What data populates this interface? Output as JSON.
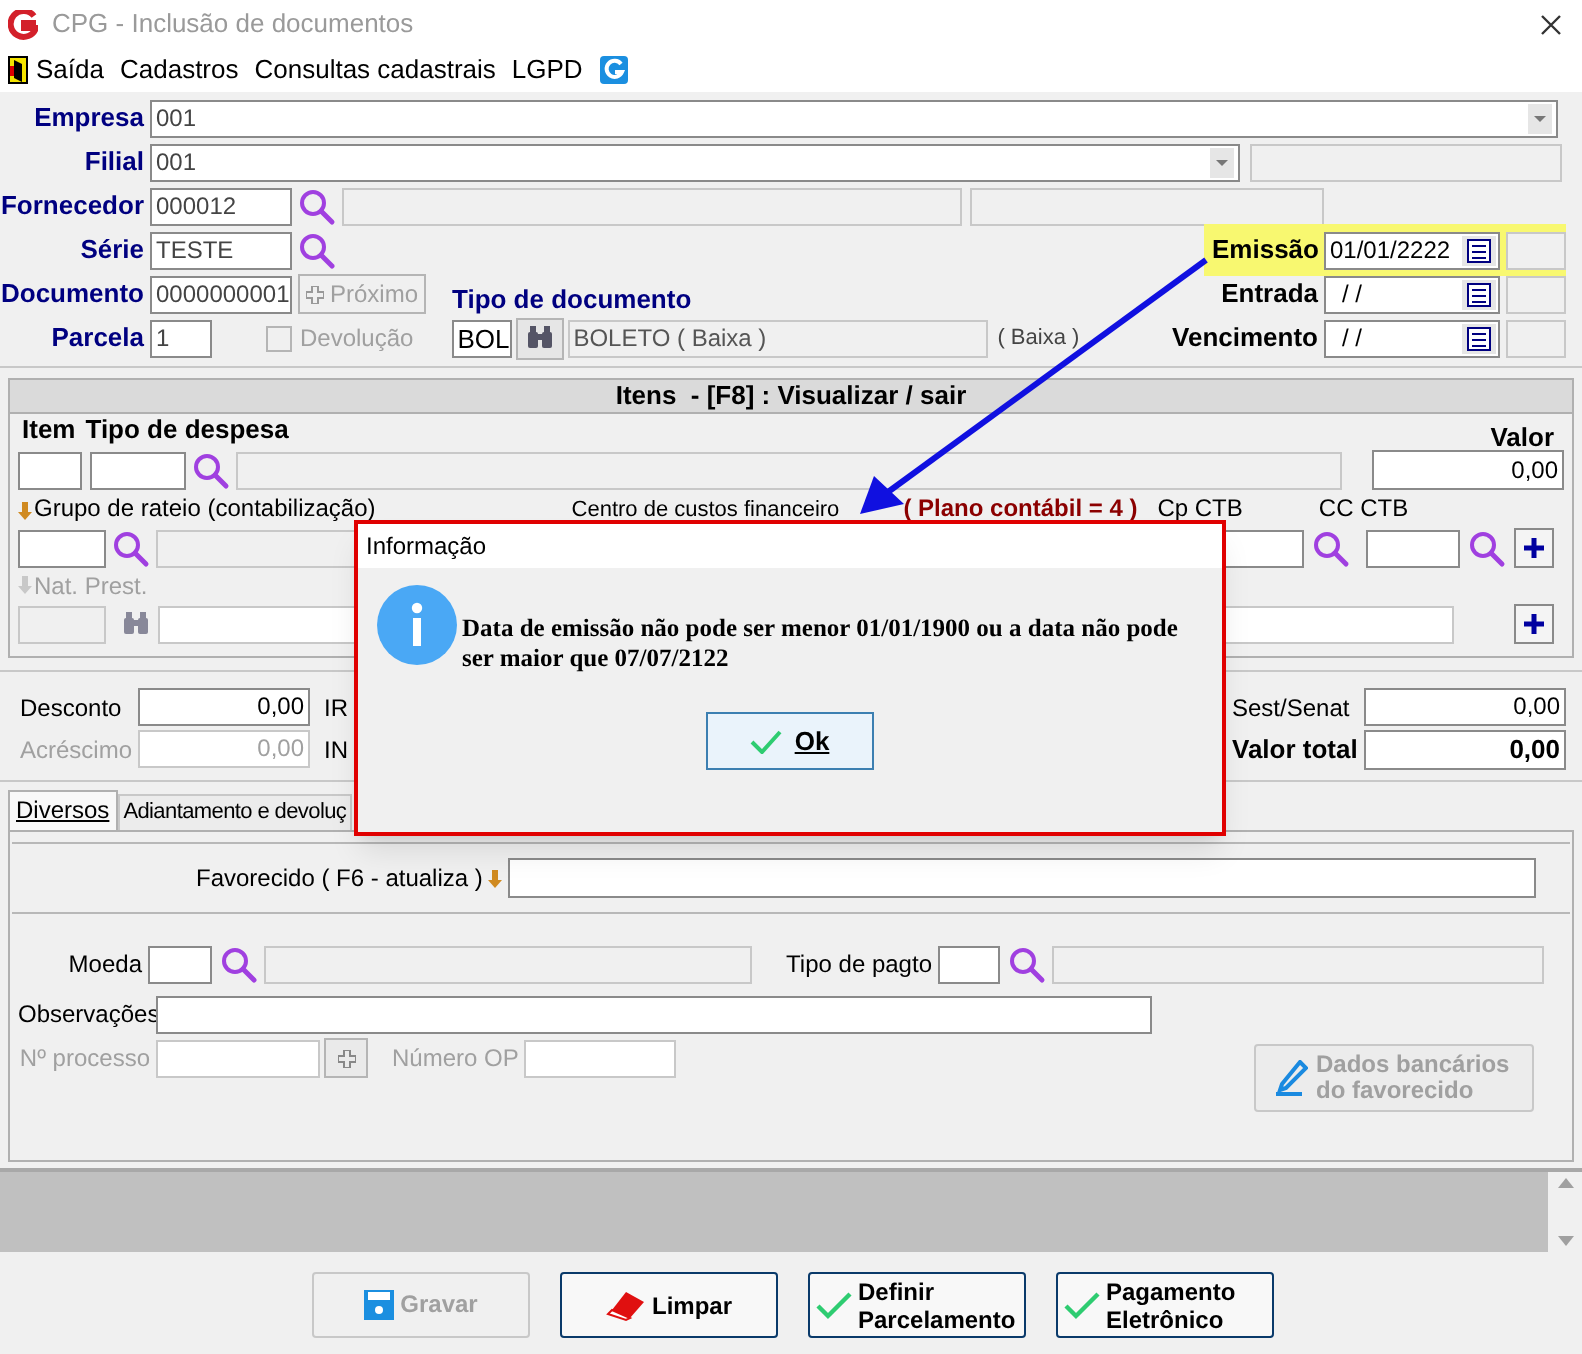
{
  "window": {
    "title": "CPG - Inclusão de documentos"
  },
  "menu": [
    {
      "label": "Saída"
    },
    {
      "label": "Cadastros"
    },
    {
      "label": "Consultas cadastrais"
    },
    {
      "label": "LGPD"
    }
  ],
  "header": {
    "empresa": {
      "label": "Empresa",
      "value": "001"
    },
    "filial": {
      "label": "Filial",
      "value": "001"
    },
    "fornecedor": {
      "label": "Fornecedor",
      "value": "000012"
    },
    "serie": {
      "label": "Série",
      "value": "TESTE"
    },
    "documento": {
      "label": "Documento",
      "value": "0000000001"
    },
    "proximo_button": {
      "label": "Próximo",
      "disabled": true
    },
    "parcela": {
      "label": "Parcela",
      "value": "1"
    },
    "devolucao": {
      "label": "Devolução",
      "checked": false,
      "disabled": true
    },
    "tipo_documento": {
      "label": "Tipo de documento",
      "code": "BOL",
      "description": "BOLETO ( Baixa )",
      "note": "( Baixa )"
    },
    "emissao": {
      "label": "Emissão",
      "value": "01/01/2222",
      "highlighted": true
    },
    "entrada": {
      "label": "Entrada",
      "value": "/ /"
    },
    "vencimento": {
      "label": "Vencimento",
      "value": "/ /"
    }
  },
  "itens": {
    "title": "Itens  - [F8] : Visualizar / sair",
    "item_label": "Item",
    "tipo_despesa_label": "Tipo de despesa",
    "valor_label": "Valor",
    "valor": "0,00",
    "grupo_rateio_label": "Grupo de rateio (contabilização)",
    "centro_custos_label": "Centro de custos financeiro",
    "plano_contabil": "( Plano contábil = 4 )",
    "cp_ctb_label": "Cp CTB",
    "cc_ctb_label": "CC CTB",
    "nat_prest": {
      "label": "Nat. Prest.",
      "disabled": true
    }
  },
  "totais": {
    "desconto": {
      "label": "Desconto",
      "value": "0,00"
    },
    "irf_label": "IR",
    "acrescimo": {
      "label": "Acréscimo",
      "value": "0,00",
      "disabled": true
    },
    "ins_label": "IN",
    "sest_senat": {
      "label": "Sest/Senat",
      "value": "0,00"
    },
    "valor_total": {
      "label": "Valor total",
      "value": "0,00"
    }
  },
  "tabs": [
    {
      "label": "Diversos",
      "selected": true
    },
    {
      "label": "Adiantamento e devoluç",
      "selected": false
    }
  ],
  "diversos": {
    "favorecido_label": "Favorecido ( F6 - atualiza )",
    "moeda_label": "Moeda",
    "tipo_pagto_label": "Tipo de pagto",
    "observacoes_label": "Observações",
    "processo": {
      "label": "Nº processo",
      "disabled": true
    },
    "numero_op": {
      "label": "Número OP",
      "disabled": true
    },
    "dados_bancarios_button": {
      "label": "Dados bancários do favorecido",
      "disabled": true
    }
  },
  "buttons": [
    {
      "label": "Gravar",
      "kind": "save",
      "disabled": true
    },
    {
      "label": "Limpar",
      "kind": "eraser",
      "disabled": false
    },
    {
      "label": "Definir Parcelamento",
      "kind": "check",
      "disabled": false
    },
    {
      "label": "Pagamento Eletrônico",
      "kind": "check",
      "disabled": false
    }
  ],
  "dialog": {
    "title": "Informação",
    "message": "Data de emissão não pode ser menor 01/01/1900 ou a data não pode ser maior que 07/07/2122",
    "ok_button": "Ok"
  }
}
